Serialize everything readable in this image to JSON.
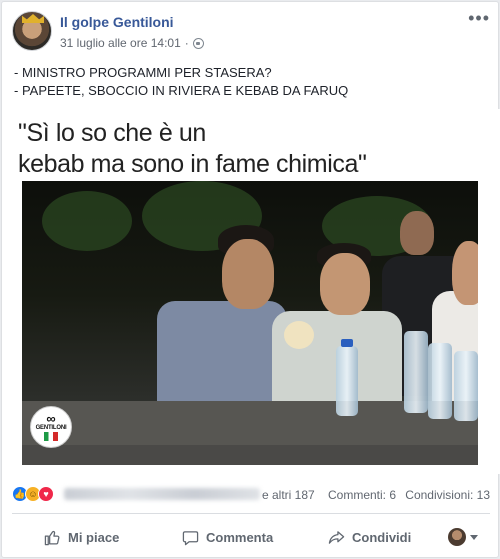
{
  "post": {
    "page_name": "Il golpe Gentiloni",
    "timestamp": "31 luglio alle ore 14:01",
    "text_lines": [
      "- MINISTRO PROGRAMMI PER STASERA?",
      "- PAPEETE, SBOCCIO IN RIVIERA E KEBAB DA FARUQ"
    ]
  },
  "meme": {
    "caption_lines": [
      "\"Sì lo so che è un",
      "kebab ma sono in fame chimica\""
    ],
    "badge_label": "GENTILONI"
  },
  "stats": {
    "others": "e altri 187",
    "comments": "Commenti: 6",
    "shares": "Condivisioni: 13"
  },
  "actions": {
    "like": "Mi piace",
    "comment": "Commenta",
    "share": "Condividi"
  },
  "colors": {
    "link": "#385898",
    "like_blue": "#1877f2",
    "haha_yellow": "#f7b125",
    "love_red": "#f0284a"
  }
}
